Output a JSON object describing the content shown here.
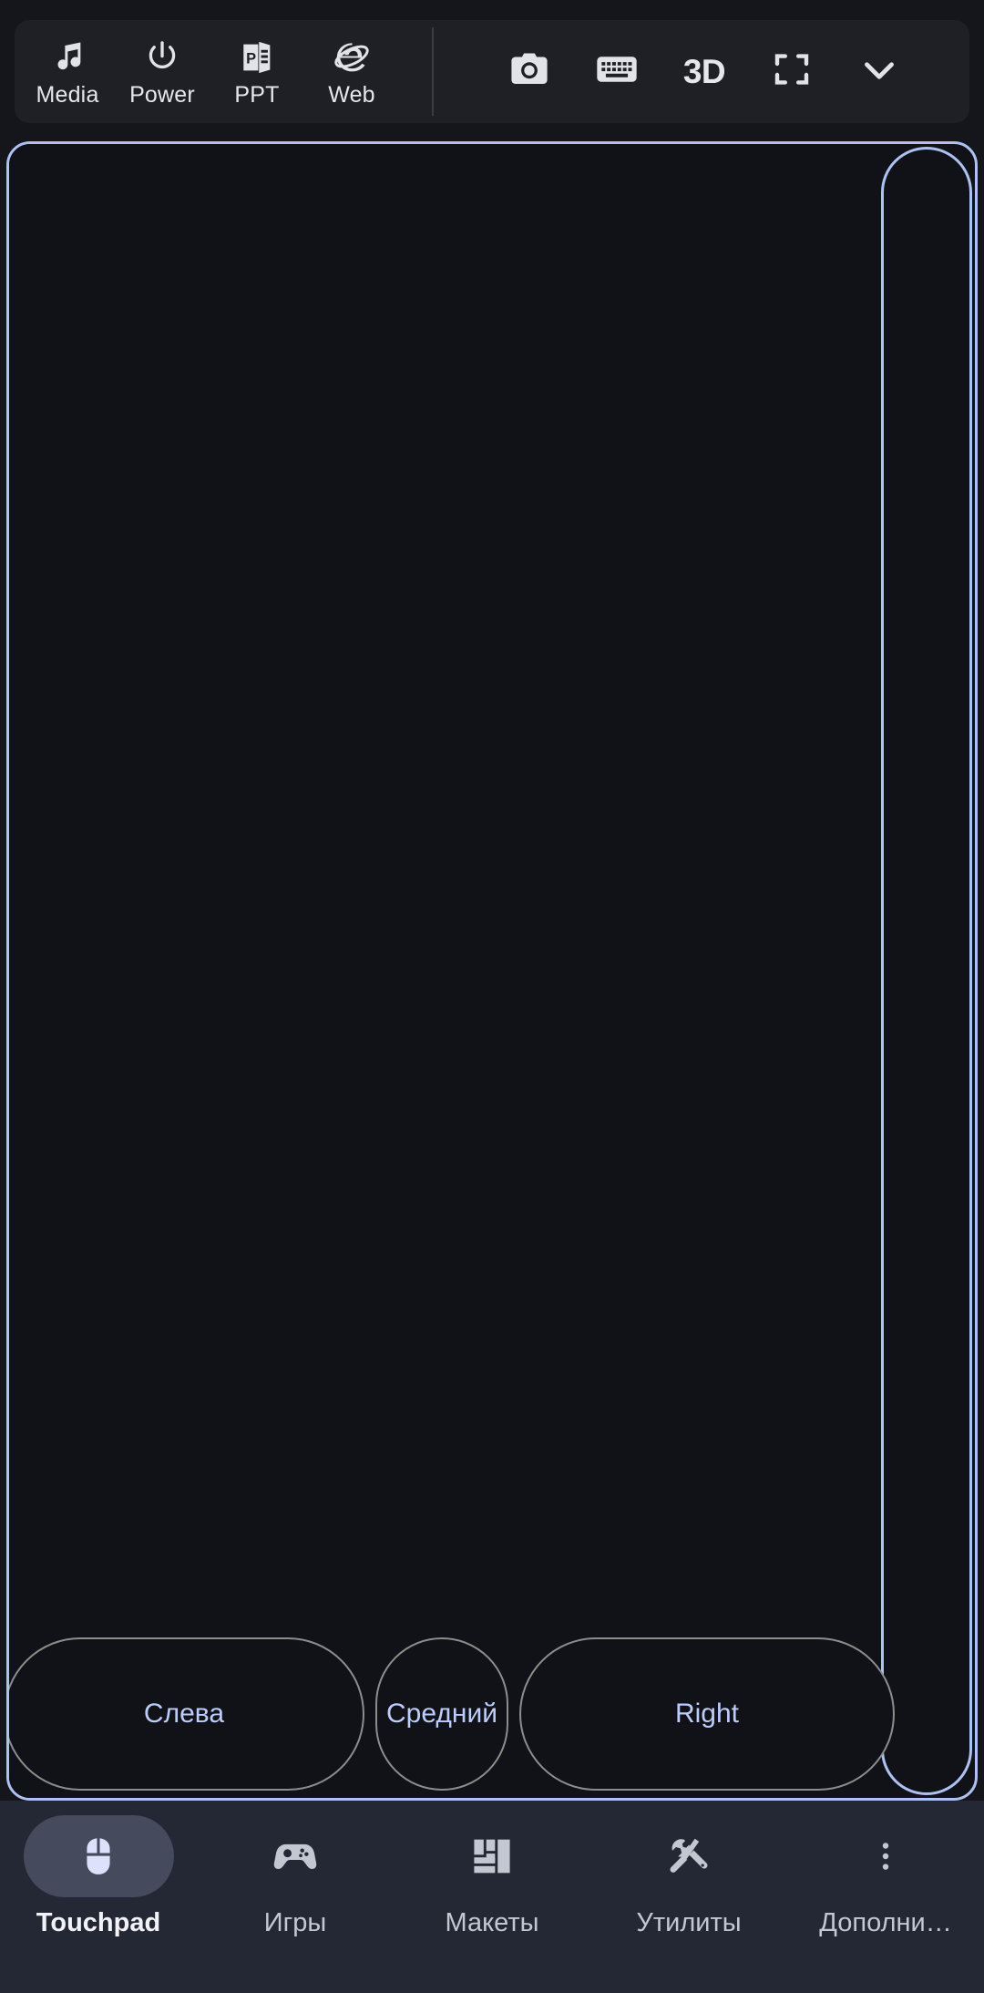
{
  "toolbar": {
    "shortcuts": [
      {
        "icon": "music-note-icon",
        "label": "Media"
      },
      {
        "icon": "power-icon",
        "label": "Power"
      },
      {
        "icon": "powerpoint-icon",
        "label": "PPT"
      },
      {
        "icon": "internet-explorer-icon",
        "label": "Web"
      }
    ],
    "actions": [
      {
        "icon": "camera-icon",
        "label": ""
      },
      {
        "icon": "keyboard-icon",
        "label": ""
      },
      {
        "icon": "3d-icon",
        "label": "3D"
      },
      {
        "icon": "fullscreen-icon",
        "label": ""
      },
      {
        "icon": "chevron-down-icon",
        "label": ""
      }
    ]
  },
  "touchpad": {
    "surface_label": "",
    "scroll_strip_label": "",
    "buttons": [
      {
        "id": "left",
        "label": "Слева"
      },
      {
        "id": "middle",
        "label": "Средний"
      },
      {
        "id": "right",
        "label": "Right"
      }
    ]
  },
  "bottom_nav": {
    "items": [
      {
        "icon": "mouse-icon",
        "label": "Touchpad",
        "active": true
      },
      {
        "icon": "gamepad-icon",
        "label": "Игры",
        "active": false
      },
      {
        "icon": "layouts-icon",
        "label": "Макеты",
        "active": false
      },
      {
        "icon": "tools-icon",
        "label": "Утилиты",
        "active": false
      },
      {
        "icon": "more-vertical-icon",
        "label": "Дополни…",
        "active": false
      }
    ]
  },
  "colors": {
    "app_background": "#14161b",
    "toolbar_panel": "#1f2026",
    "touchpad_surface": "#101217",
    "touchpad_border": "#aec2f2",
    "button_border": "#8d8d8d",
    "button_text": "#bccdfb",
    "nav_background": "#242834",
    "nav_active_pill": "#454a5c",
    "icon_light": "#e2e3e8"
  }
}
